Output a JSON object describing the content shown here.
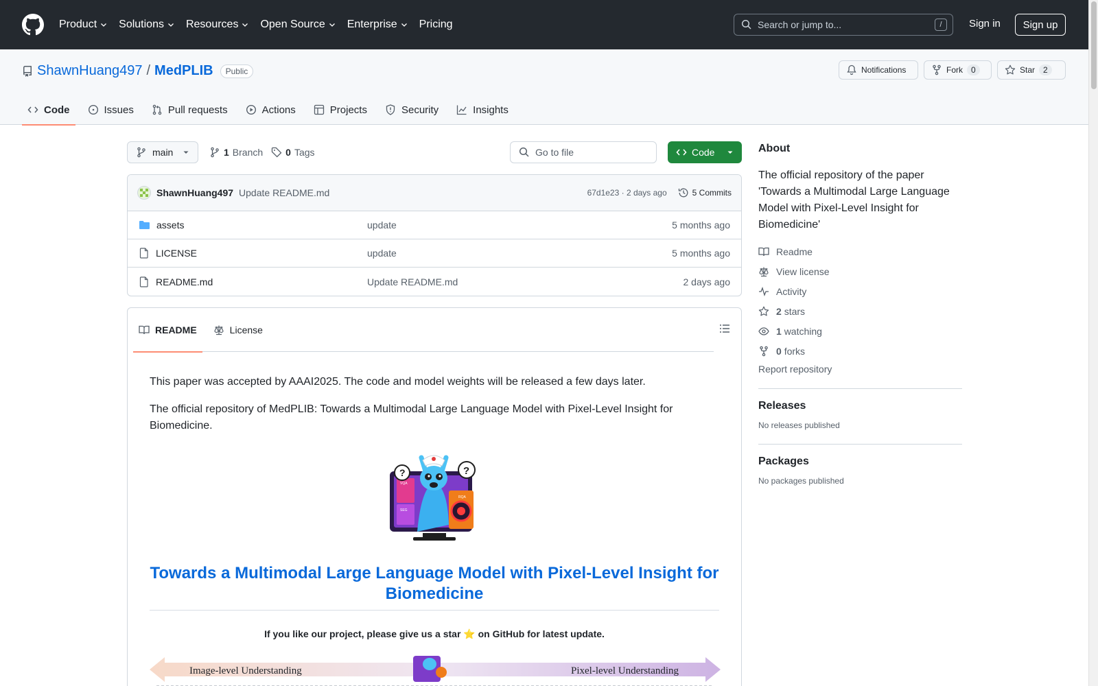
{
  "header": {
    "nav": [
      {
        "label": "Product"
      },
      {
        "label": "Solutions"
      },
      {
        "label": "Resources"
      },
      {
        "label": "Open Source"
      },
      {
        "label": "Enterprise"
      },
      {
        "label": "Pricing"
      }
    ],
    "search_placeholder": "Search or jump to...",
    "search_shortcut": "/",
    "signin": "Sign in",
    "signup": "Sign up"
  },
  "repo": {
    "owner": "ShawnHuang497",
    "separator": "/",
    "name": "MedPLIB",
    "visibility": "Public",
    "notifications": "Notifications",
    "fork_label": "Fork",
    "fork_count": "0",
    "star_label": "Star",
    "star_count": "2",
    "tabs": [
      {
        "label": "Code"
      },
      {
        "label": "Issues"
      },
      {
        "label": "Pull requests"
      },
      {
        "label": "Actions"
      },
      {
        "label": "Projects"
      },
      {
        "label": "Security"
      },
      {
        "label": "Insights"
      }
    ]
  },
  "toolbar": {
    "branch": "main",
    "branch_count": "1",
    "branch_label": "Branch",
    "tag_count": "0",
    "tag_label": "Tags",
    "goto_placeholder": "Go to file",
    "code_button": "Code"
  },
  "commit": {
    "author": "ShawnHuang497",
    "message": "Update README.md",
    "hash_time": "67d1e23 · 2 days ago",
    "commits_label": "5 Commits"
  },
  "files": [
    {
      "name": "assets",
      "message": "update",
      "time": "5 months ago",
      "type": "folder"
    },
    {
      "name": "LICENSE",
      "message": "update",
      "time": "5 months ago",
      "type": "file"
    },
    {
      "name": "README.md",
      "message": "Update README.md",
      "time": "2 days ago",
      "type": "file"
    }
  ],
  "readme": {
    "tabs": [
      {
        "label": "README"
      },
      {
        "label": "License"
      }
    ],
    "para1": "This paper was accepted by AAAI2025. The code and model weights will be released a few days later.",
    "para2": "The official repository of MedPLIB: Towards a Multimodal Large Language Model with Pixel-Level Insight for Biomedicine.",
    "logo_labels": [
      "VQA",
      "RQA",
      "SEG"
    ],
    "heading": "Towards a Multimodal Large Language Model with Pixel-Level Insight for Biomedicine",
    "star_line": "If you like our project, please give us a star ⭐ on GitHub for latest update.",
    "banner_left": "Image-level Understanding",
    "banner_right": "Pixel-level Understanding"
  },
  "sidebar": {
    "about_heading": "About",
    "description": "The official repository of the paper 'Towards a Multimodal Large Language Model with Pixel-Level Insight for Biomedicine'",
    "readme": "Readme",
    "license": "View license",
    "activity": "Activity",
    "stars_count": "2",
    "stars_label": "stars",
    "watching_count": "1",
    "watching_label": "watching",
    "forks_count": "0",
    "forks_label": "forks",
    "report": "Report repository",
    "releases_heading": "Releases",
    "releases_text": "No releases published",
    "packages_heading": "Packages",
    "packages_text": "No packages published"
  }
}
